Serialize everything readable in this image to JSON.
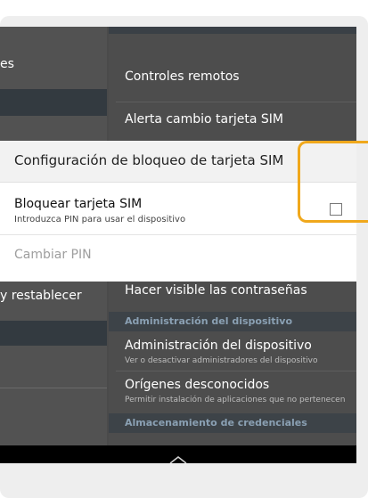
{
  "left_column": {
    "items": [
      {
        "label": "es"
      },
      {
        "label": ""
      },
      {
        "label": "y restablecer"
      }
    ]
  },
  "right_column": {
    "items": [
      {
        "title": "Controles remotos"
      },
      {
        "title": "Alerta cambio tarjeta SIM"
      },
      {
        "title": "Hacer visible las contraseñas"
      }
    ],
    "section_device_admin": "Administración del dispositivo",
    "device_admin": {
      "title": "Administración del dispositivo",
      "subtitle": "Ver o desactivar administradores del dispositivo"
    },
    "unknown_sources": {
      "title": "Orígenes desconocidos",
      "subtitle": "Permitir instalación de aplicaciones que no pertenecen"
    },
    "section_credentials": "Almacenamiento de credenciales"
  },
  "dialog": {
    "title": "Configuración de bloqueo de tarjeta SIM",
    "lock_sim": {
      "title": "Bloquear tarjeta SIM",
      "subtitle": "Introduzca PIN para usar el dispositivo",
      "checked": false
    },
    "change_pin": "Cambiar PIN"
  },
  "navbar": {
    "icon": "chevron-up-icon"
  },
  "colors": {
    "highlight": "#f0a81c",
    "section_header_text": "#8aa0b3"
  }
}
